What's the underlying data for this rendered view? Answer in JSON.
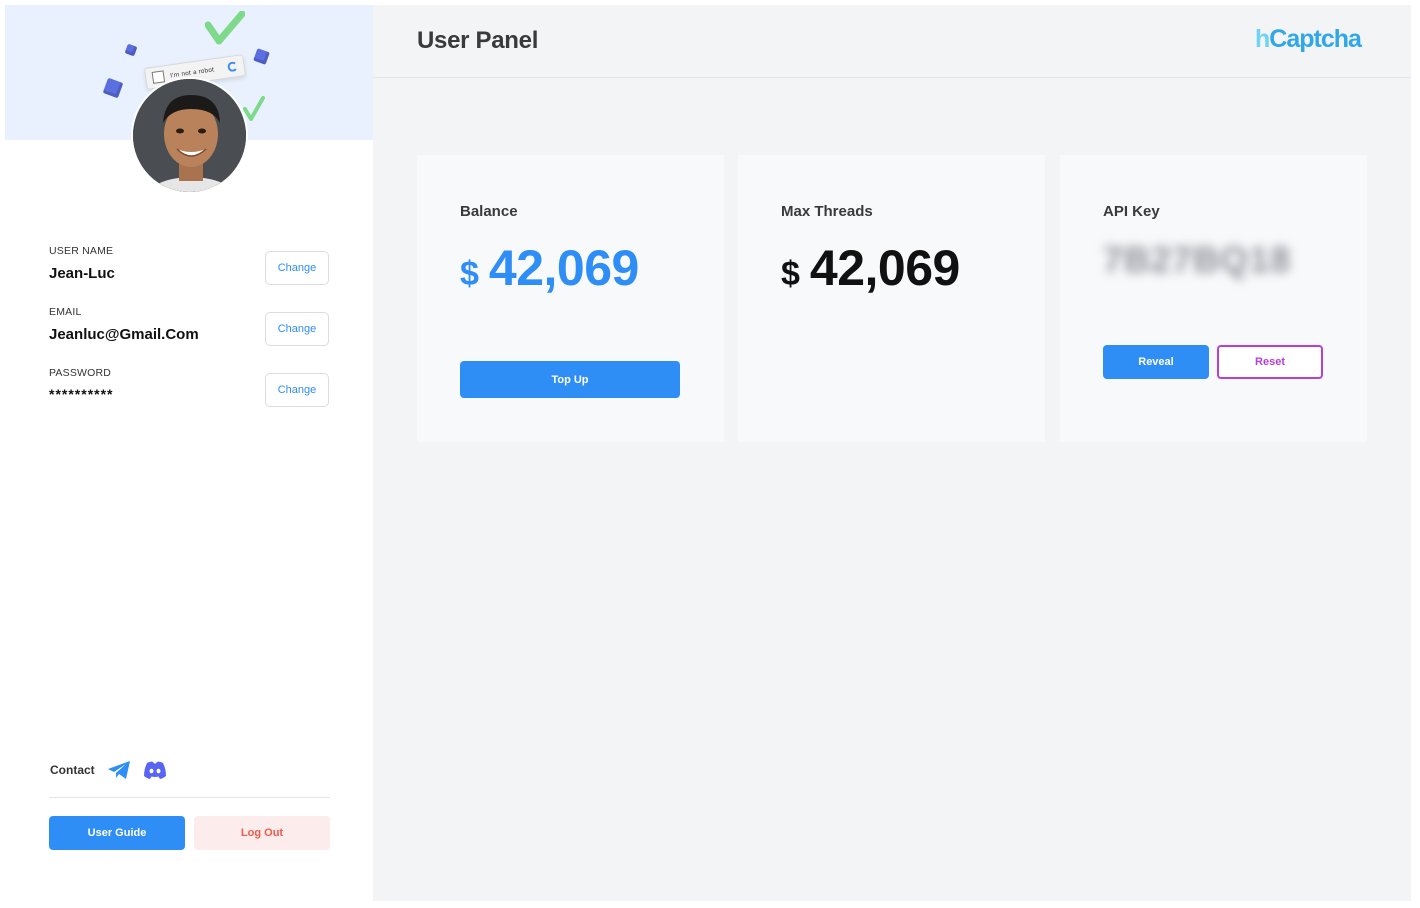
{
  "header": {
    "title": "User Panel"
  },
  "brand": {
    "logo_part1": "h",
    "logo_part2": "Captcha",
    "color_light": "#6fd3f5",
    "color_dark": "#2fa7e8"
  },
  "sidebar": {
    "banner": {
      "robot_text": "I'm not a robot"
    },
    "profile": {
      "fields": [
        {
          "label": "USER NAME",
          "value": "Jean-Luc",
          "action": "Change"
        },
        {
          "label": "EMAIL",
          "value": "Jeanluc@Gmail.Com",
          "action": "Change"
        },
        {
          "label": "PASSWORD",
          "value": "**********",
          "action": "Change"
        }
      ]
    },
    "contact": {
      "label": "Contact",
      "icons": [
        "telegram-icon",
        "discord-icon"
      ]
    },
    "buttons": {
      "user_guide": "User Guide",
      "log_out": "Log Out"
    }
  },
  "cards": {
    "balance": {
      "title": "Balance",
      "currency": "$",
      "amount": "42,069",
      "button": "Top Up"
    },
    "max_threads": {
      "title": "Max Threads",
      "currency": "$",
      "amount": "42,069"
    },
    "api_key": {
      "title": "API Key",
      "value": "7B27BQ18",
      "reveal": "Reveal",
      "reset": "Reset"
    }
  },
  "colors": {
    "accent": "#2f8ef5",
    "danger": "#ef5a4a",
    "danger_bg": "#fdecec",
    "reset": "#b43fd9",
    "banner_bg": "#e8f1fd"
  }
}
